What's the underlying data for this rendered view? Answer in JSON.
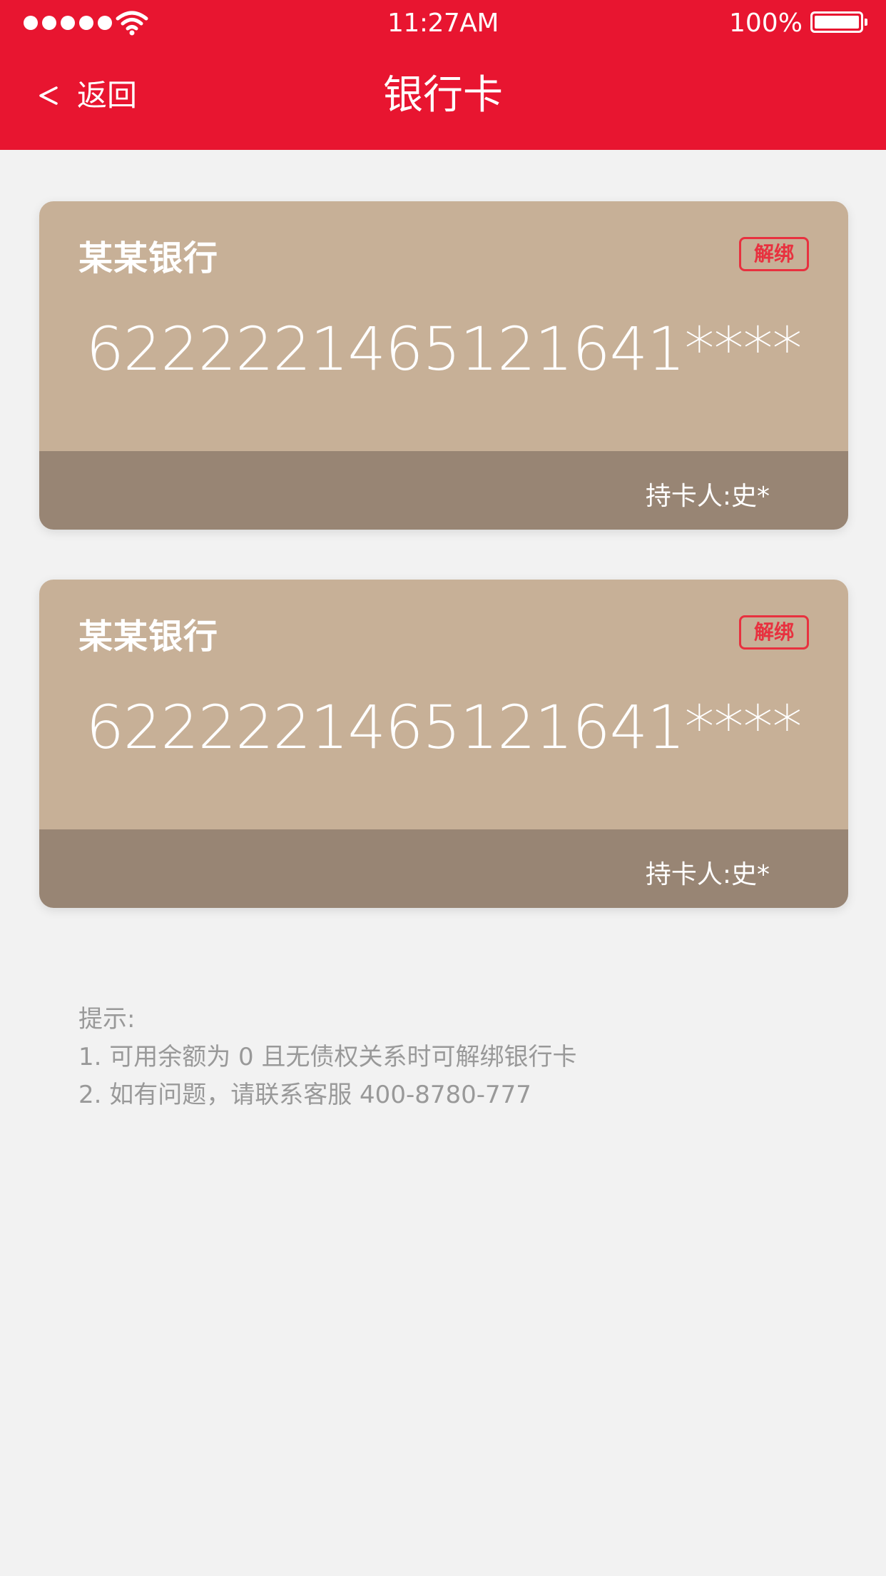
{
  "status_bar": {
    "time": "11:27AM",
    "battery": "100%"
  },
  "nav": {
    "back_label": "返回",
    "title": "银行卡"
  },
  "cards": [
    {
      "bank": "某某银行",
      "unbind_label": "解绑",
      "number": "6222221465121641****",
      "holder": "持卡人:史*"
    },
    {
      "bank": "某某银行",
      "unbind_label": "解绑",
      "number": "6222221465121641****",
      "holder": "持卡人:史*"
    }
  ],
  "tips": {
    "title": "提示:",
    "lines": [
      "1. 可用余额为 0 且无债权关系时可解绑银行卡",
      "2. 如有问题，请联系客服 400-8780-777"
    ]
  },
  "colors": {
    "header": "#e81530",
    "card_top": "#c7b097",
    "card_bottom": "#988574",
    "unbind": "#e8313f",
    "background": "#f2f2f2",
    "tip_text": "#999999"
  },
  "icons": {
    "signal": "signal-dots-icon",
    "wifi": "wifi-icon",
    "battery": "battery-icon",
    "back": "chevron-left-icon"
  }
}
